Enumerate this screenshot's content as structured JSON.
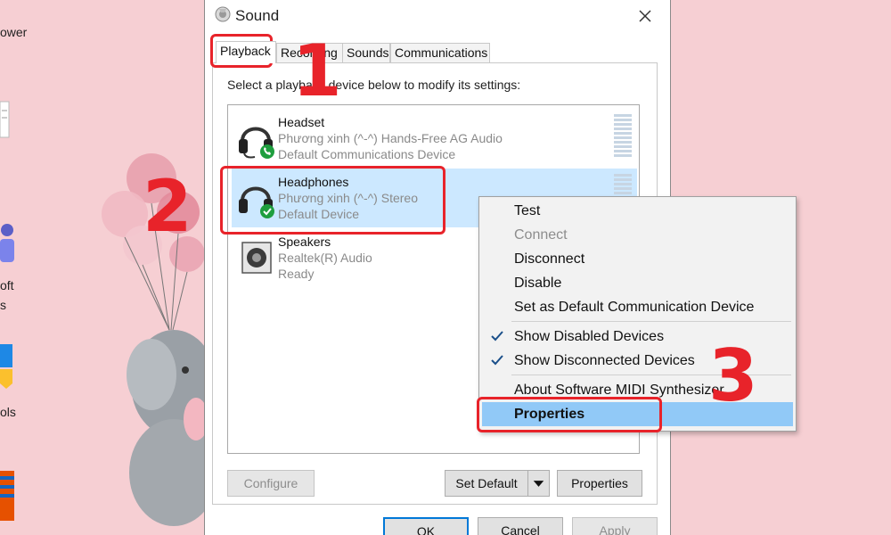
{
  "desktop": {
    "labels": [
      "ower",
      "oft",
      "s",
      "ols"
    ]
  },
  "dialog": {
    "title": "Sound",
    "tabs": [
      {
        "label": "Playback",
        "active": true
      },
      {
        "label": "Recording",
        "active": false
      },
      {
        "label": "Sounds",
        "active": false
      },
      {
        "label": "Communications",
        "active": false
      }
    ],
    "instruction": "Select a playback device below to modify its settings:",
    "devices": [
      {
        "name": "Headset",
        "line1": "Phương xinh (^-^) Hands-Free AG Audio",
        "line2": "Default Communications Device",
        "icon": "headset-phone-icon",
        "selected": false
      },
      {
        "name": "Headphones",
        "line1": "Phương xinh (^-^) Stereo",
        "line2": "Default Device",
        "icon": "headphones-check-icon",
        "selected": true
      },
      {
        "name": "Speakers",
        "line1": "Realtek(R) Audio",
        "line2": "Ready",
        "icon": "speaker-icon",
        "selected": false
      }
    ],
    "buttons": {
      "configure": "Configure",
      "set_default": "Set Default",
      "properties": "Properties",
      "ok": "OK",
      "cancel": "Cancel",
      "apply": "Apply"
    }
  },
  "context_menu": {
    "items": [
      {
        "label": "Test",
        "disabled": false,
        "checked": false
      },
      {
        "label": "Connect",
        "disabled": true,
        "checked": false
      },
      {
        "label": "Disconnect",
        "disabled": false,
        "checked": false
      },
      {
        "label": "Disable",
        "disabled": false,
        "checked": false
      },
      {
        "label": "Set as Default Communication Device",
        "disabled": false,
        "checked": false
      },
      {
        "label": "Show Disabled Devices",
        "disabled": false,
        "checked": true
      },
      {
        "label": "Show Disconnected Devices",
        "disabled": false,
        "checked": true
      },
      {
        "label": "About Software MIDI Synthesizer",
        "disabled": false,
        "checked": false
      },
      {
        "label": "Properties",
        "disabled": false,
        "checked": false,
        "highlighted": true
      }
    ]
  },
  "annotations": {
    "step1": "1",
    "step2": "2",
    "step3": "3",
    "color": "#e8232a"
  },
  "colors": {
    "selection": "#cce8ff",
    "menu_highlight": "#91c9f7",
    "accent": "#0078d7",
    "desktop": "#f6cfd3"
  }
}
